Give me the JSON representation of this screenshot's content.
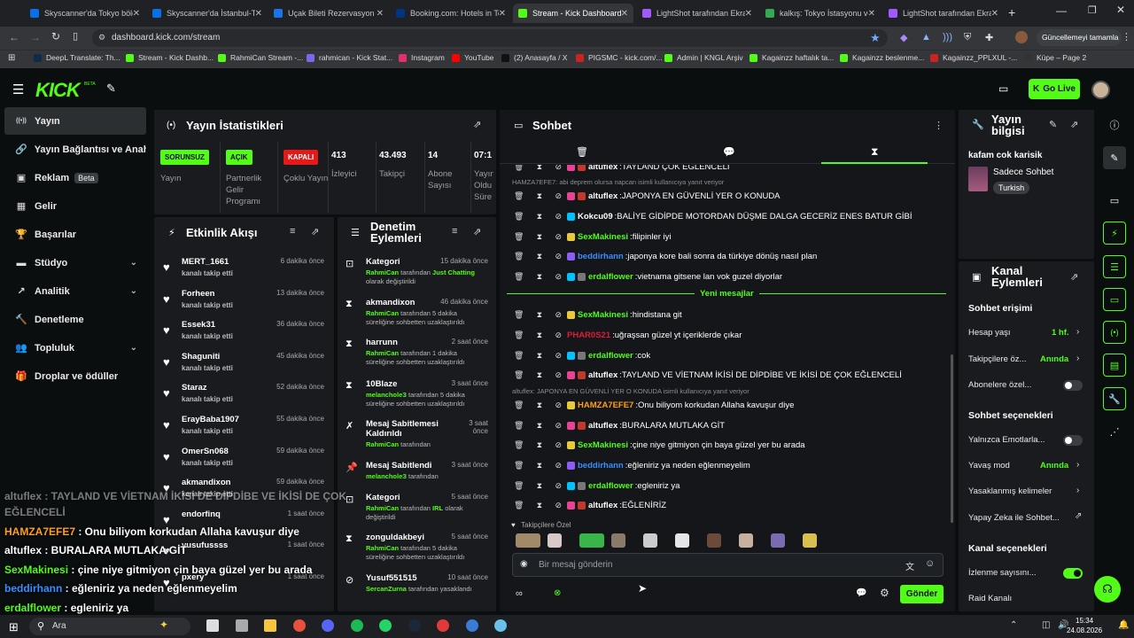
{
  "browser": {
    "tabs": [
      {
        "title": "Skyscanner'da Tokyo bölg",
        "color": "#0770e3"
      },
      {
        "title": "Skyscanner'da İstanbul-T",
        "color": "#0770e3"
      },
      {
        "title": "Uçak Bileti Rezervasyon D",
        "color": "#1a73e8"
      },
      {
        "title": "Booking.com: Hotels in To",
        "color": "#003580"
      },
      {
        "title": "Stream - Kick Dashboard",
        "color": "#53fc18"
      },
      {
        "title": "LightShot tarafından Ekra",
        "color": "#a259ff"
      },
      {
        "title": "kalkış: Tokyo İstasyonu ve",
        "color": "#34a853"
      },
      {
        "title": "LightShot tarafından Ekra",
        "color": "#a259ff"
      }
    ],
    "url": "dashboard.kick.com/stream",
    "update_label": "Güncellemeyi tamamla",
    "bookmarks": [
      {
        "label": "DeepL Translate: Th...",
        "color": "#0f2b46"
      },
      {
        "label": "Stream - Kick Dashb...",
        "color": "#53fc18"
      },
      {
        "label": "RahmiCan Stream -...",
        "color": "#53fc18"
      },
      {
        "label": "rahmican - Kick Stat...",
        "color": "#7b68ee"
      },
      {
        "label": "Instagram",
        "color": "#e1306c"
      },
      {
        "label": "YouTube",
        "color": "#ff0000"
      },
      {
        "label": "(2) Anasayfa / X",
        "color": "#111111"
      },
      {
        "label": "PIGSMC - kick.com/...",
        "color": "#cc2222"
      },
      {
        "label": "Admin | KNGL Arşiv",
        "color": "#53fc18"
      },
      {
        "label": "Kagainzz haftalık ta...",
        "color": "#53fc18"
      },
      {
        "label": "Kagainzz beslenme...",
        "color": "#53fc18"
      },
      {
        "label": "Kagainzz_PPLXUL -...",
        "color": "#cc2222"
      },
      {
        "label": "Küpe – Page 2",
        "color": "#333333"
      }
    ]
  },
  "header": {
    "logo": "KICK",
    "go_live": "Go Live"
  },
  "sidebar": {
    "items": [
      {
        "label": "Yayın",
        "icon": "broadcast-icon",
        "glyph": "((•))"
      },
      {
        "label": "Yayın Bağlantısı ve Anahtar",
        "icon": "link-icon",
        "glyph": "🔗"
      },
      {
        "label": "Reklam",
        "icon": "ad-icon",
        "glyph": "▣",
        "badge": "Beta"
      },
      {
        "label": "Gelir",
        "icon": "revenue-icon",
        "glyph": "▦"
      },
      {
        "label": "Başarılar",
        "icon": "trophy-icon",
        "glyph": "🏆"
      },
      {
        "label": "Stüdyo",
        "icon": "studio-icon",
        "glyph": "▬"
      },
      {
        "label": "Analitik",
        "icon": "analytics-icon",
        "glyph": "↗"
      },
      {
        "label": "Denetleme",
        "icon": "moderation-icon",
        "glyph": "🔨"
      },
      {
        "label": "Topluluk",
        "icon": "community-icon",
        "glyph": "👥"
      },
      {
        "label": "Droplar ve ödüller",
        "icon": "drops-icon",
        "glyph": "🎁"
      }
    ]
  },
  "stats": {
    "title": "Yayın İstatistikleri",
    "cols": [
      {
        "pill": "SORUNSUZ",
        "pill_color": "#53fc18",
        "pill_text": "#0b0e0f",
        "label": "Yayın"
      },
      {
        "pill": "AÇIK",
        "pill_color": "#53fc18",
        "pill_text": "#0b0e0f",
        "label": "Partnerlik Gelir Programı"
      },
      {
        "pill": "KAPALI",
        "pill_color": "#e21a1a",
        "pill_text": "#ffffff",
        "label": "Çoklu Yayın"
      },
      {
        "value": "413",
        "label": "İzleyici"
      },
      {
        "value": "43.493",
        "label": "Takipçi"
      },
      {
        "value": "14",
        "label": "Abone Sayısı"
      },
      {
        "value": "07:1",
        "label": "Yayın Oldu Süre"
      }
    ]
  },
  "activity": {
    "title": "Etkinlik Akışı",
    "rows": [
      {
        "name": "MERT_1661",
        "sub": "kanalı takip etti",
        "time": "6 dakika önce"
      },
      {
        "name": "Forheen",
        "sub": "kanalı takip etti",
        "time": "13 dakika önce"
      },
      {
        "name": "Essek31",
        "sub": "kanalı takip etti",
        "time": "36 dakika önce"
      },
      {
        "name": "Shaguniti",
        "sub": "kanalı takip etti",
        "time": "45 dakika önce"
      },
      {
        "name": "Staraz",
        "sub": "kanalı takip etti",
        "time": "52 dakika önce"
      },
      {
        "name": "ErayBaba1907",
        "sub": "kanalı takip etti",
        "time": "55 dakika önce"
      },
      {
        "name": "OmerSn068",
        "sub": "kanalı takip etti",
        "time": "59 dakika önce"
      },
      {
        "name": "akmandixon",
        "sub": "kanalı takip etti",
        "time": "59 dakika önce"
      },
      {
        "name": "endorfinq",
        "sub": "",
        "time": "1 saat önce"
      },
      {
        "name": "yusufussss",
        "sub": "",
        "time": "1 saat önce"
      },
      {
        "name": "pxery",
        "sub": "",
        "time": "1 saat önce"
      }
    ]
  },
  "moderation": {
    "title": "Denetim Eylemleri",
    "rows": [
      {
        "icon": "tag-icon",
        "glyph": "⊡",
        "name": "Kategori",
        "time": "15 dakika önce",
        "actor": "RahmiCan",
        "text": " tarafından ",
        "hl": "Just Chatting",
        "rest": " olarak değiştirildi"
      },
      {
        "icon": "hourglass-icon",
        "glyph": "⧗",
        "name": "akmandixon",
        "time": "46 dakika önce",
        "actor": "RahmiCan",
        "text": " tarafından 5 dakika süreliğine sohbetten uzaklaştırıldı",
        "hl": "",
        "rest": ""
      },
      {
        "icon": "hourglass-icon",
        "glyph": "⧗",
        "name": "harrunn",
        "time": "2 saat önce",
        "actor": "RahmiCan",
        "text": " tarafından 1 dakika süreliğine sohbetten uzaklaştırıldı",
        "hl": "",
        "rest": ""
      },
      {
        "icon": "hourglass-icon",
        "glyph": "⧗",
        "name": "10Blaze",
        "time": "3 saat önce",
        "actor": "melancholeЗ",
        "text": " tarafından 5 dakika süreliğine sohbetten uzaklaştırıldı",
        "hl": "",
        "rest": ""
      },
      {
        "icon": "unpin-icon",
        "glyph": "✗",
        "name": "Mesaj Sabitlemesi Kaldırıldı",
        "time": "3 saat önce",
        "actor": "RahmiCan",
        "text": " tarafından",
        "hl": "",
        "rest": ""
      },
      {
        "icon": "pin-icon",
        "glyph": "📌",
        "name": "Mesaj Sabitlendi",
        "time": "3 saat önce",
        "actor": "melancholeЗ",
        "text": " tarafından",
        "hl": "",
        "rest": ""
      },
      {
        "icon": "tag-icon",
        "glyph": "⊡",
        "name": "Kategori",
        "time": "5 saat önce",
        "actor": "RahmiCan",
        "text": " tarafından ",
        "hl": "IRL",
        "rest": " olarak değiştirildi"
      },
      {
        "icon": "hourglass-icon",
        "glyph": "⧗",
        "name": "zonguldakbeyi",
        "time": "5 saat önce",
        "actor": "RahmiCan",
        "text": " tarafından 5 dakika süreliğine sohbetten uzaklaştırıldı",
        "hl": "",
        "rest": ""
      },
      {
        "icon": "ban-icon",
        "glyph": "⊘",
        "name": "Yusuf551515",
        "time": "10 saat önce",
        "actor": "SercanZurna",
        "text": " tarafından yasaklandı",
        "hl": "",
        "rest": ""
      }
    ]
  },
  "chat": {
    "title": "Sohbet",
    "new_messages": "Yeni mesajlar",
    "followers_only": "Takipçilere Özel",
    "input_placeholder": "Bir mesaj gönderin",
    "send": "Gönder",
    "messages": [
      {
        "user": "altuflex",
        "color": "#ffffff",
        "badge": "#e84393",
        "msg": "TAYLAND ÇOK EGLENCELI",
        "reply": ""
      },
      {
        "user": "altuflex",
        "color": "#ffffff",
        "badge": "#e84393",
        "msg": "JAPONYA EN GÜVENLİ YER O KONUDA",
        "reply": "HAMZA7EFE7: abi deprem olursa napcan isimli kullanıcıya yanıt veriyor"
      },
      {
        "user": "Kokcu09",
        "color": "#ffffff",
        "badge": "#00c2ff",
        "msg": "BALİYE GİDİPDE MOTORDAN DÜŞME DALGA GECERİZ ENES BATUR GİBİ",
        "reply": ""
      },
      {
        "user": "SexMakinesi",
        "color": "#53fc18",
        "badge": "#e8c93a",
        "msg": "filipinler iyi",
        "reply": ""
      },
      {
        "user": "beddirhann",
        "color": "#3a8dff",
        "badge": "#8b5cf6",
        "msg": "japonya kore bali sonra da türkiye dönüş nasıl plan",
        "reply": ""
      },
      {
        "user": "erdalflower",
        "color": "#53fc18",
        "badge": "#00c2ff",
        "msg": "vietnama gitsene lan vok guzel diyorlar",
        "reply": ""
      },
      {
        "user": "SexMakinesi",
        "color": "#53fc18",
        "badge": "#e8c93a",
        "msg": "hindistana git",
        "reply": ""
      },
      {
        "user": "PHAR0S21",
        "color": "#e21a3a",
        "badge": "",
        "msg": "uğraşsan güzel yt içeriklerde çıkar",
        "reply": ""
      },
      {
        "user": "erdalflower",
        "color": "#53fc18",
        "badge": "#00c2ff",
        "msg": "cok",
        "reply": ""
      },
      {
        "user": "altuflex",
        "color": "#ffffff",
        "badge": "#e84393",
        "msg": "TAYLAND VE VİETNAM İKİSİ DE DİPDİBE VE İKİSİ DE ÇOK EĞLENCELİ",
        "reply": ""
      },
      {
        "user": "HAMZA7EFE7",
        "color": "#ff9f1a",
        "badge": "#e8c93a",
        "msg": "Onu biliyom korkudan Allaha kavuşur diye",
        "reply": "altuflex: JAPONYA EN GÜVENLİ YER O KONUDA isimli kullanıcıya yanıt veriyor"
      },
      {
        "user": "altuflex",
        "color": "#ffffff",
        "badge": "#e84393",
        "msg": "BURALARA MUTLAKA GİT",
        "reply": ""
      },
      {
        "user": "SexMakinesi",
        "color": "#53fc18",
        "badge": "#e8c93a",
        "msg": "çine niye gitmiyon çin baya güzel yer bu arada",
        "reply": ""
      },
      {
        "user": "beddirhann",
        "color": "#3a8dff",
        "badge": "#8b5cf6",
        "msg": "eğleniriz ya neden eğlenmeyelim",
        "reply": ""
      },
      {
        "user": "erdalflower",
        "color": "#53fc18",
        "badge": "#00c2ff",
        "msg": "egleniriz ya",
        "reply": ""
      },
      {
        "user": "altuflex",
        "color": "#ffffff",
        "badge": "#e84393",
        "msg": "EĞLENİRİZ",
        "reply": ""
      }
    ]
  },
  "stream_info": {
    "title": "Yayın bilgisi",
    "stream_title": "kafam cok karisik",
    "category": "Sadece Sohbet",
    "tag": "Turkish"
  },
  "channel_actions": {
    "title": "Kanal Eylemleri",
    "chat_access": "Sohbet erişimi",
    "account_age": "Hesap yaşı",
    "account_age_val": "1 hf.",
    "followers_only": "Takipçilere öz...",
    "followers_only_val": "Anında",
    "subs_only": "Abonelere özel...",
    "chat_options": "Sohbet seçenekleri",
    "emotes_only": "Yalnızca Emotlarla...",
    "slow_mode": "Yavaş mod",
    "slow_mode_val": "Anında",
    "banned_words": "Yasaklanmış kelimeler",
    "ai_chat": "Yapay Zeka ile Sohbet...",
    "channel_options": "Kanal seçenekleri",
    "view_count": "İzlenme sayısını...",
    "raid": "Raid Kanalı"
  },
  "overlay": {
    "lines": [
      {
        "user": "altuflex",
        "text": " : TAYLAND VE VİETNAM İKİSİ DE DİPDİBE VE İKİSİ DE ÇOK",
        "color": "#ffffff"
      },
      {
        "user": "",
        "text": "EĞLENCELİ",
        "color": "#ffffff"
      },
      {
        "user": "HAMZA7EFE7",
        "text": " : Onu biliyom korkudan Allaha kavuşur diye",
        "color": "#ff9f1a"
      },
      {
        "user": "altuflex",
        "text": " : BURALARA MUTLAKA GİT",
        "color": "#ffffff"
      },
      {
        "user": "SexMakinesi",
        "text": " : çine niye gitmiyon çin baya güzel yer bu arada",
        "color": "#53fc18"
      },
      {
        "user": "beddirhann",
        "text": " : eğleniriz ya neden eğlenmeyelim",
        "color": "#3a8dff"
      },
      {
        "user": "erdalflower",
        "text": " : egleniriz ya",
        "color": "#53fc18"
      }
    ]
  },
  "taskbar": {
    "search": "Ara",
    "time": "15:34",
    "date": "24.08.2026"
  }
}
